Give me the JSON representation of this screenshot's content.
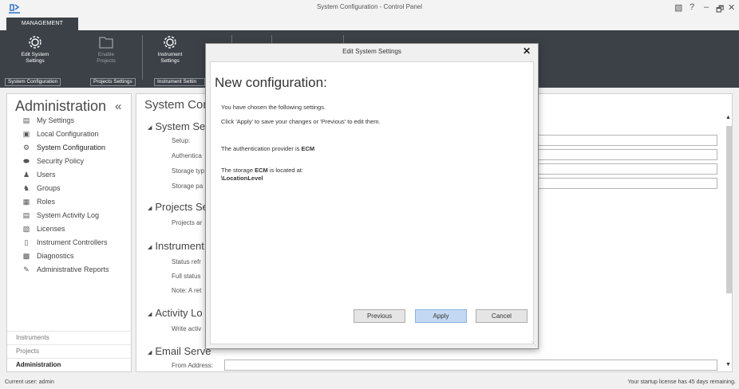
{
  "window": {
    "title": "System Configuration - Control Panel",
    "controls": [
      "🖒",
      "?",
      "–",
      "🗗",
      "✕"
    ]
  },
  "ribbon": {
    "tab": "MANAGEMENT",
    "buttons": {
      "edit_system": "Edit System\nSettings",
      "enable_projects": "Enable\nProjects",
      "instrument": "Instrument\nSettings"
    },
    "groups": {
      "system_configuration": "System Configuration",
      "projects_settings": "Projects Settings",
      "instrument_settings": "Instrument Settin"
    }
  },
  "left_panel": {
    "title": "Administration",
    "collapse_glyph": "«",
    "nav": [
      {
        "label": "My Settings",
        "icon": "my-settings-icon"
      },
      {
        "label": "Local Configuration",
        "icon": "local-configuration-icon"
      },
      {
        "label": "System Configuration",
        "icon": "system-configuration-icon"
      },
      {
        "label": "Security Policy",
        "icon": "security-policy-icon"
      },
      {
        "label": "Users",
        "icon": "users-icon"
      },
      {
        "label": "Groups",
        "icon": "groups-icon"
      },
      {
        "label": "Roles",
        "icon": "roles-icon"
      },
      {
        "label": "System Activity Log",
        "icon": "activity-log-icon"
      },
      {
        "label": "Licenses",
        "icon": "licenses-icon"
      },
      {
        "label": "Instrument Controllers",
        "icon": "instrument-controllers-icon"
      },
      {
        "label": "Diagnostics",
        "icon": "diagnostics-icon"
      },
      {
        "label": "Administrative Reports",
        "icon": "administrative-reports-icon"
      }
    ],
    "sections": [
      "Instruments",
      "Projects",
      "Administration"
    ]
  },
  "main": {
    "title": "System Cor",
    "sections": {
      "system": {
        "header": "System Set",
        "rows": [
          "Setup:",
          "Authentica",
          "Storage typ",
          "Storage pa"
        ]
      },
      "projects": {
        "header": "Projects Se",
        "rows": [
          "Projects ar"
        ]
      },
      "instrument": {
        "header": "Instrument",
        "rows": [
          "Status refr",
          "Full status",
          "Note: A ret"
        ]
      },
      "activity": {
        "header": "Activity Lo",
        "rows": [
          "Write activ"
        ]
      },
      "email": {
        "header": "Email Serve",
        "rows": [
          "From Address:"
        ]
      }
    }
  },
  "dialog": {
    "title": "Edit System Settings",
    "close": "✕",
    "heading": "New configuration:",
    "line1": "You have chosen the following settings.",
    "line2": "Click 'Apply' to save your changes or 'Previous' to edit them.",
    "auth_prefix": "The authentication provider is ",
    "auth_value": "ECM",
    "storage_prefix": "The storage ",
    "storage_value": "ECM",
    "storage_suffix": " is located at:",
    "location": "\\LocationLevel",
    "buttons": {
      "previous": "Previous",
      "apply": "Apply",
      "cancel": "Cancel"
    }
  },
  "statusbar": {
    "left": "Current user: admin",
    "right": "Your startup license has 45 days remaining."
  },
  "colors": {
    "ribbon_bg": "#3c4147",
    "apply_bg": "#c3d9f3"
  }
}
